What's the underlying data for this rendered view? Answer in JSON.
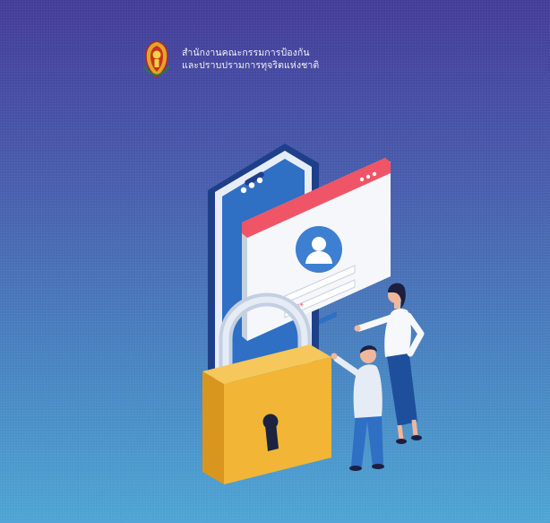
{
  "organization": {
    "name_line1": "สำนักงานคณะกรรมการป้องกัน",
    "name_line2": "และปราบปรามการทุจริตแห่งชาติ",
    "emblem": "nacc-emblem"
  },
  "illustration": {
    "subject": "secure-login",
    "icons": [
      "smartphone-icon",
      "login-window-icon",
      "user-avatar-icon",
      "padlock-icon",
      "keyhole-icon"
    ],
    "password_mask": "*****"
  },
  "colors": {
    "background_top": "#453d9a",
    "background_bottom": "#4fa6d6",
    "padlock": "#f2b535",
    "window_bar": "#ef5566",
    "phone_screen": "#2f6fc4"
  }
}
